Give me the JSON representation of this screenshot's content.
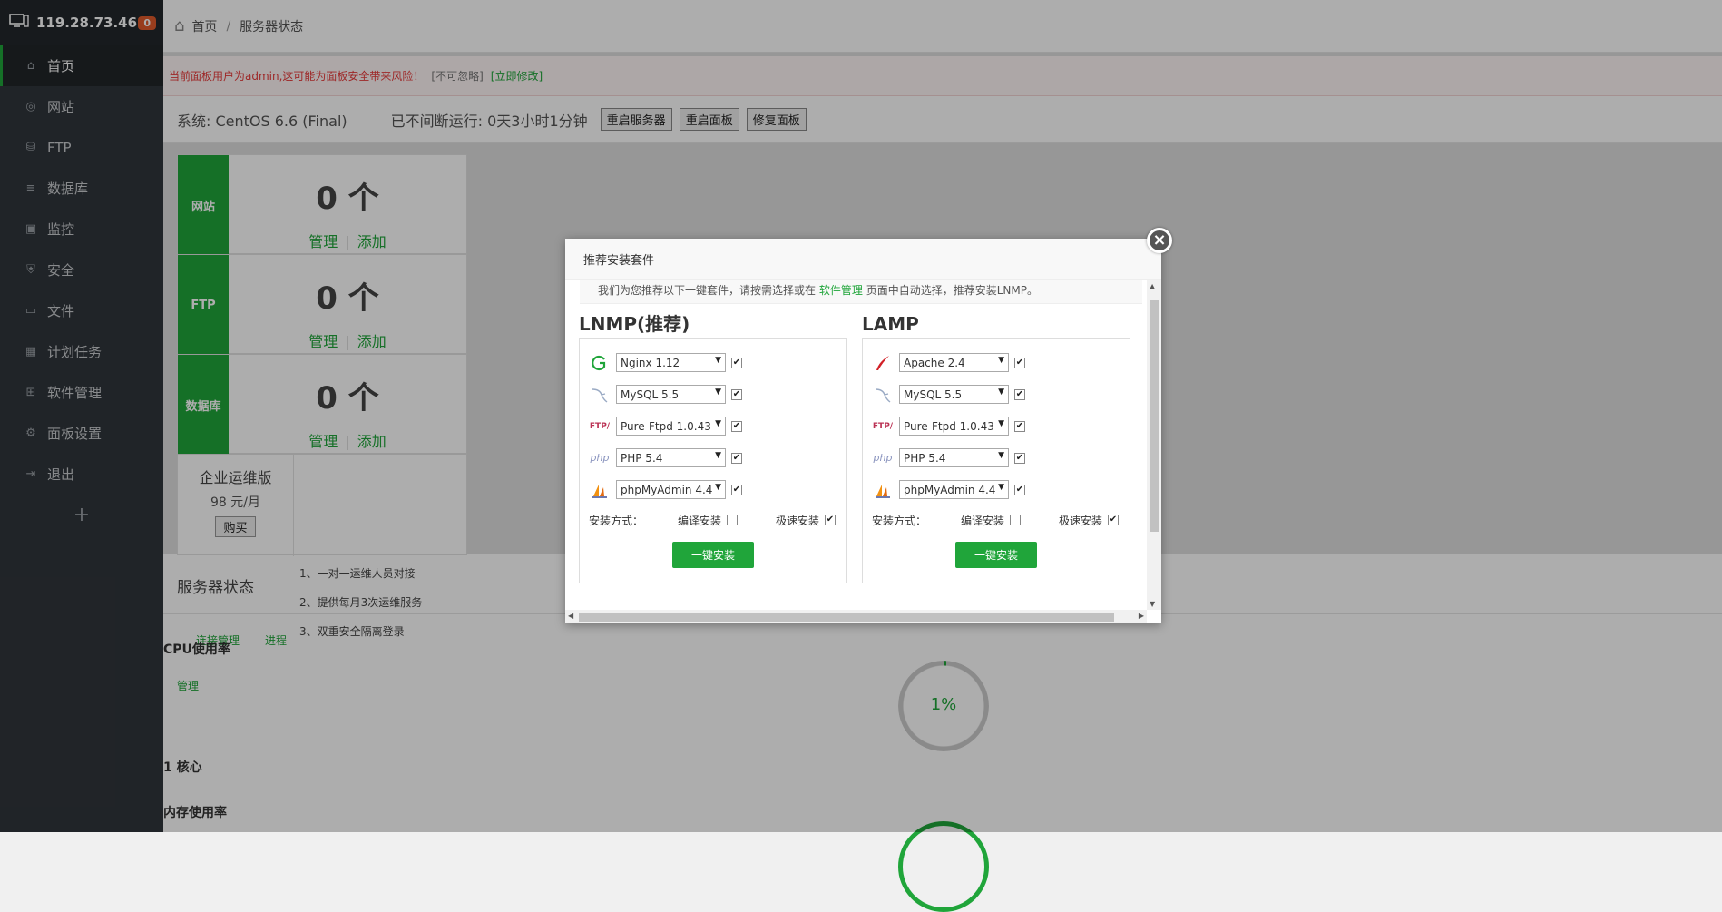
{
  "sidebar": {
    "host": "119.28.73.46",
    "badge": "0",
    "items": [
      {
        "label": "首页",
        "icon": "home-icon"
      },
      {
        "label": "网站",
        "icon": "globe-icon"
      },
      {
        "label": "FTP",
        "icon": "ftp-icon"
      },
      {
        "label": "数据库",
        "icon": "database-icon"
      },
      {
        "label": "监控",
        "icon": "monitor-icon"
      },
      {
        "label": "安全",
        "icon": "shield-icon"
      },
      {
        "label": "文件",
        "icon": "folder-icon"
      },
      {
        "label": "计划任务",
        "icon": "calendar-icon"
      },
      {
        "label": "软件管理",
        "icon": "apps-icon"
      },
      {
        "label": "面板设置",
        "icon": "gear-icon"
      },
      {
        "label": "退出",
        "icon": "logout-icon"
      }
    ],
    "add": "+"
  },
  "breadcrumb": {
    "home": "首页",
    "sep": "/",
    "current": "服务器状态"
  },
  "warning": {
    "text": "当前面板用户为admin,这可能为面板安全带来风险！",
    "ignore": "[不可忽略]",
    "fix": "[立即修改]"
  },
  "system": {
    "os": "系统: CentOS 6.6 (Final)",
    "uptime": "已不间断运行: 0天3小时1分钟",
    "buttons": {
      "restart_server": "重启服务器",
      "restart_panel": "重启面板",
      "repair_panel": "修复面板"
    }
  },
  "cards": [
    {
      "label": "网站",
      "count": "0 个",
      "manage": "管理",
      "add": "添加"
    },
    {
      "label": "FTP",
      "count": "0 个",
      "manage": "管理",
      "add": "添加"
    },
    {
      "label": "数据库",
      "count": "0 个",
      "manage": "管理",
      "add": "添加"
    }
  ],
  "enterprise": {
    "name": "企业运维版",
    "price": "98 元/月",
    "buy": "购买",
    "features": [
      "1、一对一运维人员对接",
      "2、提供每月3次运维服务",
      "3、双重安全隔离登录"
    ]
  },
  "status": {
    "title": "服务器状态",
    "tabs": {
      "conn": "连接管理",
      "proc": "进程",
      "manage": "管理"
    },
    "cpu_label": "CPU使用率",
    "cpu_value": "1%",
    "cpu_fraction": 0.01,
    "cores": "1 核心",
    "mem_label": "内存使用率"
  },
  "modal": {
    "title": "推荐安装套件",
    "tip_pre": "我们为您推荐以下一键套件，请按需选择或在",
    "tip_link": "软件管理",
    "tip_post": "页面中自动选择，推荐安装LNMP。",
    "install_mode_label": "安装方式：",
    "compile_label": "编译安装",
    "fast_label": "极速安装",
    "install_button": "一键安装",
    "lnmp": {
      "title": "LNMP(推荐)",
      "rows": [
        {
          "icon": "nginx-icon",
          "value": "Nginx 1.12",
          "checked": true
        },
        {
          "icon": "mysql-icon",
          "value": "MySQL 5.5",
          "checked": true
        },
        {
          "icon": "ftp-icon",
          "value": "Pure-Ftpd 1.0.43",
          "checked": true
        },
        {
          "icon": "php-icon",
          "value": "PHP 5.4",
          "checked": true
        },
        {
          "icon": "phpmyadmin-icon",
          "value": "phpMyAdmin 4.4",
          "checked": true
        }
      ]
    },
    "lamp": {
      "title": "LAMP",
      "rows": [
        {
          "icon": "apache-icon",
          "value": "Apache 2.4",
          "checked": true
        },
        {
          "icon": "mysql-icon",
          "value": "MySQL 5.5",
          "checked": true
        },
        {
          "icon": "ftp-icon",
          "value": "Pure-Ftpd 1.0.43",
          "checked": true
        },
        {
          "icon": "php-icon",
          "value": "PHP 5.4",
          "checked": true
        },
        {
          "icon": "phpmyadmin-icon",
          "value": "phpMyAdmin 4.4",
          "checked": true
        }
      ]
    },
    "colors": {
      "accent": "#20a53a",
      "warning": "#e83b3b"
    }
  }
}
